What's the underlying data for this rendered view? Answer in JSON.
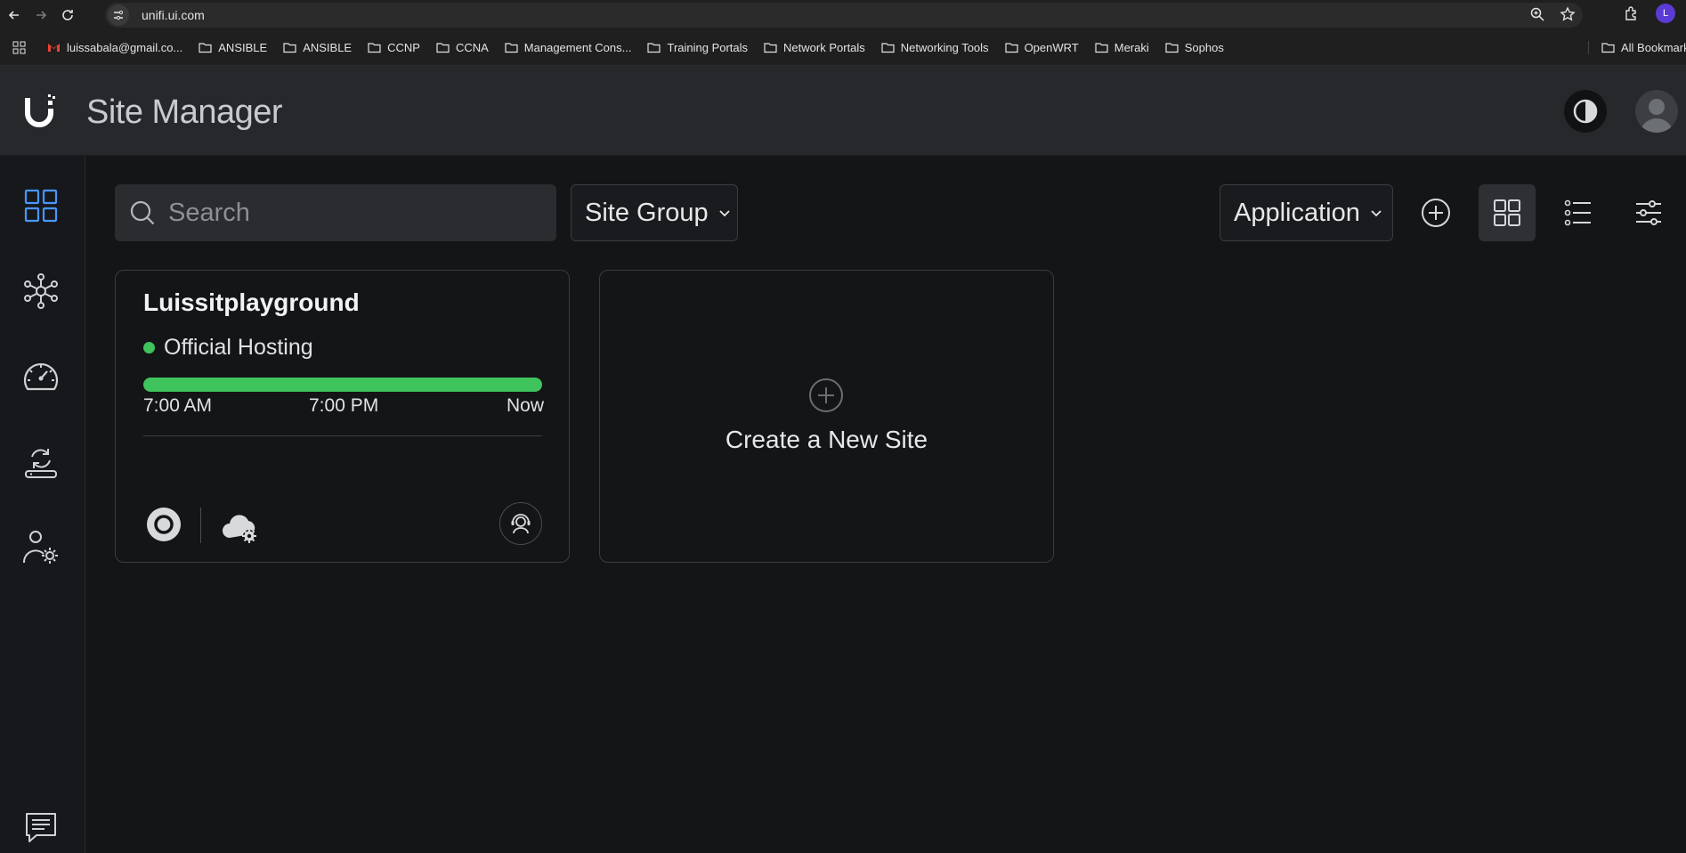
{
  "browser": {
    "url": "unifi.ui.com",
    "profile_initial": "L",
    "bookmarks": [
      {
        "label": "luissabala@gmail.co...",
        "icon": "gmail-icon"
      },
      {
        "label": "ANSIBLE",
        "icon": "folder-icon"
      },
      {
        "label": "ANSIBLE",
        "icon": "folder-icon"
      },
      {
        "label": "CCNP",
        "icon": "folder-icon"
      },
      {
        "label": "CCNA",
        "icon": "folder-icon"
      },
      {
        "label": "Management Cons...",
        "icon": "folder-icon"
      },
      {
        "label": "Training Portals",
        "icon": "folder-icon"
      },
      {
        "label": "Network Portals",
        "icon": "folder-icon"
      },
      {
        "label": "Networking Tools",
        "icon": "folder-icon"
      },
      {
        "label": "OpenWRT",
        "icon": "folder-icon"
      },
      {
        "label": "Meraki",
        "icon": "folder-icon"
      },
      {
        "label": "Sophos",
        "icon": "folder-icon"
      }
    ],
    "all_bookmarks": "All Bookmarks"
  },
  "header": {
    "title": "Site Manager"
  },
  "sidenav": {
    "items": [
      {
        "name": "dashboard-grid-icon",
        "active": true
      },
      {
        "name": "topology-icon",
        "active": false
      },
      {
        "name": "speedometer-icon",
        "active": false
      },
      {
        "name": "backup-sync-icon",
        "active": false
      },
      {
        "name": "user-settings-icon",
        "active": false
      }
    ],
    "feedback": "feedback-icon"
  },
  "toolbar": {
    "search_placeholder": "Search",
    "site_group_label": "Site Group",
    "application_label": "Application"
  },
  "sites": [
    {
      "name": "Luissitplayground",
      "hosting": "Official Hosting",
      "uptime_percent": 100,
      "times": [
        "7:00 AM",
        "7:00 PM",
        "Now"
      ]
    }
  ],
  "create_card": {
    "label": "Create a New Site"
  },
  "colors": {
    "accent": "#4797ff",
    "online": "#3ec35d",
    "background": "#141517",
    "header": "#26282c"
  }
}
